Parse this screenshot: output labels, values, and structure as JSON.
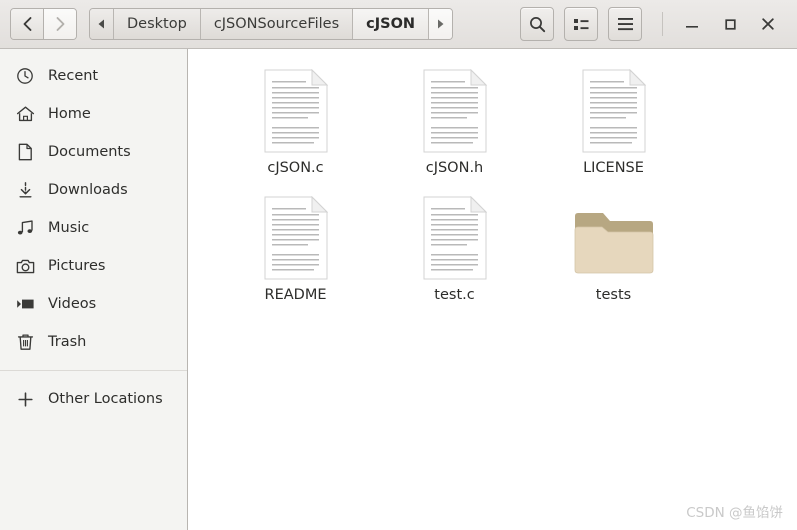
{
  "window": {
    "title": "cJSON",
    "controls": {
      "minimize_label": "Minimize",
      "maximize_label": "Maximize",
      "close_label": "Close"
    }
  },
  "header": {
    "nav": {
      "back_label": "Back",
      "forward_label": "Forward"
    },
    "breadcrumb": {
      "scroll_left_label": "◀",
      "scroll_right_label": "▶",
      "items": [
        {
          "label": "Desktop",
          "active": false
        },
        {
          "label": "cJSONSourceFiles",
          "active": false
        },
        {
          "label": "cJSON",
          "active": true
        }
      ]
    },
    "toolbar": {
      "search_label": "Search",
      "view_toggle_label": "View options",
      "menu_label": "Menu"
    }
  },
  "sidebar": {
    "items": [
      {
        "label": "Recent",
        "icon": "clock-icon"
      },
      {
        "label": "Home",
        "icon": "home-icon"
      },
      {
        "label": "Documents",
        "icon": "document-icon"
      },
      {
        "label": "Downloads",
        "icon": "download-icon"
      },
      {
        "label": "Music",
        "icon": "music-icon"
      },
      {
        "label": "Pictures",
        "icon": "camera-icon"
      },
      {
        "label": "Videos",
        "icon": "video-icon"
      },
      {
        "label": "Trash",
        "icon": "trash-icon"
      }
    ],
    "other_locations": {
      "label": "Other Locations",
      "icon": "plus-icon"
    }
  },
  "files": [
    {
      "name": "cJSON.c",
      "type": "document"
    },
    {
      "name": "cJSON.h",
      "type": "document"
    },
    {
      "name": "LICENSE",
      "type": "document"
    },
    {
      "name": "README",
      "type": "document"
    },
    {
      "name": "test.c",
      "type": "document"
    },
    {
      "name": "tests",
      "type": "folder"
    }
  ],
  "watermark": {
    "text": "CSDN @鱼馅饼"
  },
  "colors": {
    "header_bg": "#e6e3e0",
    "sidebar_bg": "#f4f4f2",
    "content_bg": "#ffffff",
    "folder_front": "#e6d7bd",
    "folder_back": "#b7a782",
    "text": "#2d2d2b"
  }
}
